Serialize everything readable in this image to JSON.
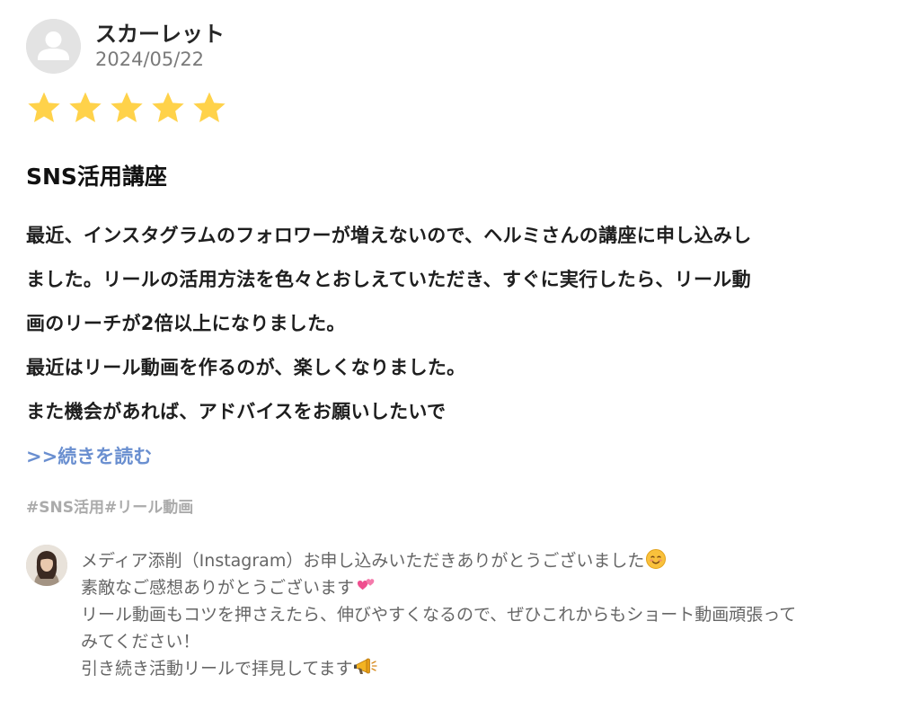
{
  "review": {
    "reviewer_name": "スカーレット",
    "date": "2024/05/22",
    "rating": 5,
    "rating_max": 5,
    "star_color": "#ffd24a",
    "title": "SNS活用講座",
    "body_lines": [
      "最近、インスタグラムのフォロワーが増えないので、ヘルミさんの講座に申し込みし",
      "ました。リールの活用方法を色々とおしえていただき、すぐに実行したら、リール動",
      "画のリーチが2倍以上になりました。",
      "最近はリール動画を作るのが、楽しくなりました。",
      "また機会があれば、アドバイスをお願いしたいで"
    ],
    "read_more": ">>続きを読む",
    "read_more_color": "#6a8fd0",
    "tags": [
      "#SNS活用",
      "#リール動画"
    ]
  },
  "reply": {
    "lines": [
      "メディア添削（Instagram）お申し込みいただきありがとうございました",
      "素敵なご感想ありがとうございます",
      "リール動画もコツを押さえたら、伸びやすくなるので、ぜひこれからもショート動画頑張って",
      "みてください！",
      "引き続き活動リールで拝見してます"
    ],
    "emojis": [
      "smiling-face-icon",
      "two-hearts-icon",
      "megaphone-icon"
    ]
  }
}
